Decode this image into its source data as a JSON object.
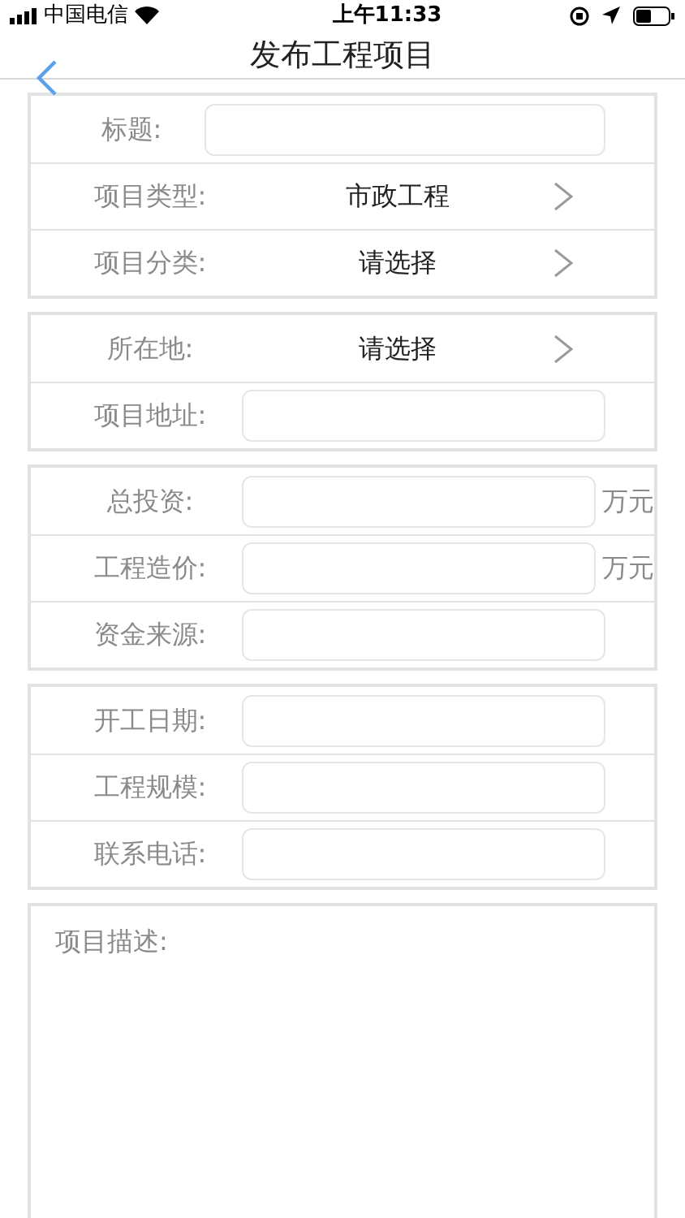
{
  "status_bar": {
    "carrier": "中国电信",
    "time": "上午11:33"
  },
  "nav": {
    "title": "发布工程项目"
  },
  "sections": [
    {
      "rows": [
        {
          "kind": "input",
          "label": "标题:"
        },
        {
          "kind": "select",
          "label": "项目类型:",
          "value": "市政工程"
        },
        {
          "kind": "select",
          "label": "项目分类:",
          "value": "请选择"
        }
      ]
    },
    {
      "rows": [
        {
          "kind": "select",
          "label": "所在地:",
          "value": "请选择"
        },
        {
          "kind": "input",
          "label": "项目地址:"
        }
      ]
    },
    {
      "rows": [
        {
          "kind": "input",
          "label": "总投资:",
          "unit": "万元"
        },
        {
          "kind": "input",
          "label": "工程造价:",
          "unit": "万元"
        },
        {
          "kind": "input",
          "label": "资金来源:"
        }
      ]
    },
    {
      "rows": [
        {
          "kind": "input",
          "label": "开工日期:"
        },
        {
          "kind": "input",
          "label": "工程规模:"
        },
        {
          "kind": "input",
          "label": "联系电话:"
        }
      ]
    }
  ],
  "description": {
    "label": "项目描述:"
  }
}
